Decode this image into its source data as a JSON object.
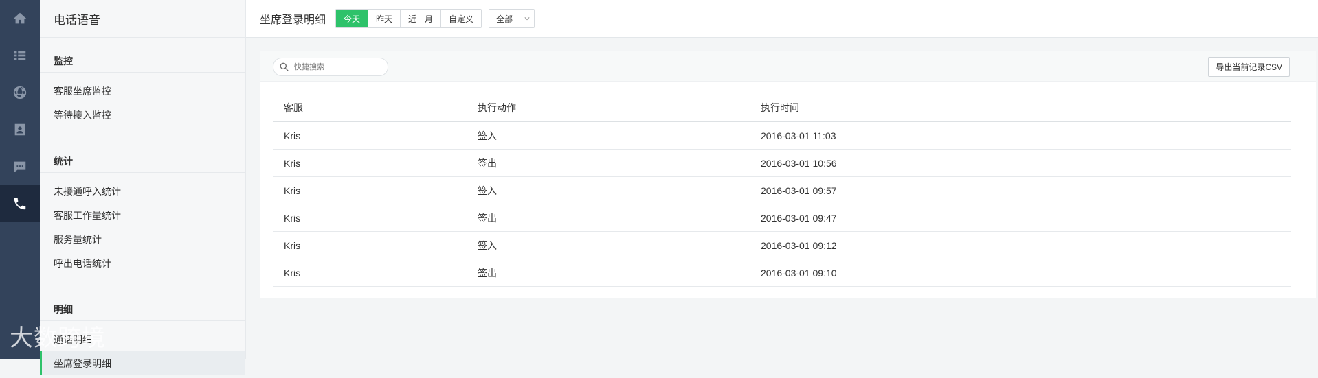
{
  "rail": {
    "items": [
      {
        "icon": "home-icon"
      },
      {
        "icon": "list-icon"
      },
      {
        "icon": "globe-icon"
      },
      {
        "icon": "contact-card-icon"
      },
      {
        "icon": "chat-icon"
      },
      {
        "icon": "phone-icon",
        "active": true
      }
    ]
  },
  "sidebar": {
    "title": "电话语音",
    "sections": [
      {
        "label": "监控",
        "items": [
          "客服坐席监控",
          "等待接入监控"
        ]
      },
      {
        "label": "统计",
        "items": [
          "未接通呼入统计",
          "客服工作量统计",
          "服务量统计",
          "呼出电话统计"
        ]
      },
      {
        "label": "明细",
        "items": [
          "通话明细",
          "坐席登录明细"
        ]
      }
    ],
    "active_item": "坐席登录明细"
  },
  "header": {
    "title": "坐席登录明细",
    "range_buttons": [
      "今天",
      "昨天",
      "近一月",
      "自定义"
    ],
    "range_selected": "今天",
    "filter_selected": "全部"
  },
  "toolbar": {
    "search_placeholder": "快捷搜索",
    "export_label": "导出当前记录CSV"
  },
  "table": {
    "columns": [
      "客服",
      "执行动作",
      "执行时间"
    ],
    "rows": [
      [
        "Kris",
        "签入",
        "2016-03-01 11:03"
      ],
      [
        "Kris",
        "签出",
        "2016-03-01 10:56"
      ],
      [
        "Kris",
        "签入",
        "2016-03-01 09:57"
      ],
      [
        "Kris",
        "签出",
        "2016-03-01 09:47"
      ],
      [
        "Kris",
        "签入",
        "2016-03-01 09:12"
      ],
      [
        "Kris",
        "签出",
        "2016-03-01 09:10"
      ]
    ]
  },
  "watermark": "大数跨境",
  "colors": {
    "accent": "#2ec26a",
    "rail": "#33435b",
    "rail_active": "#1e2a3e"
  }
}
